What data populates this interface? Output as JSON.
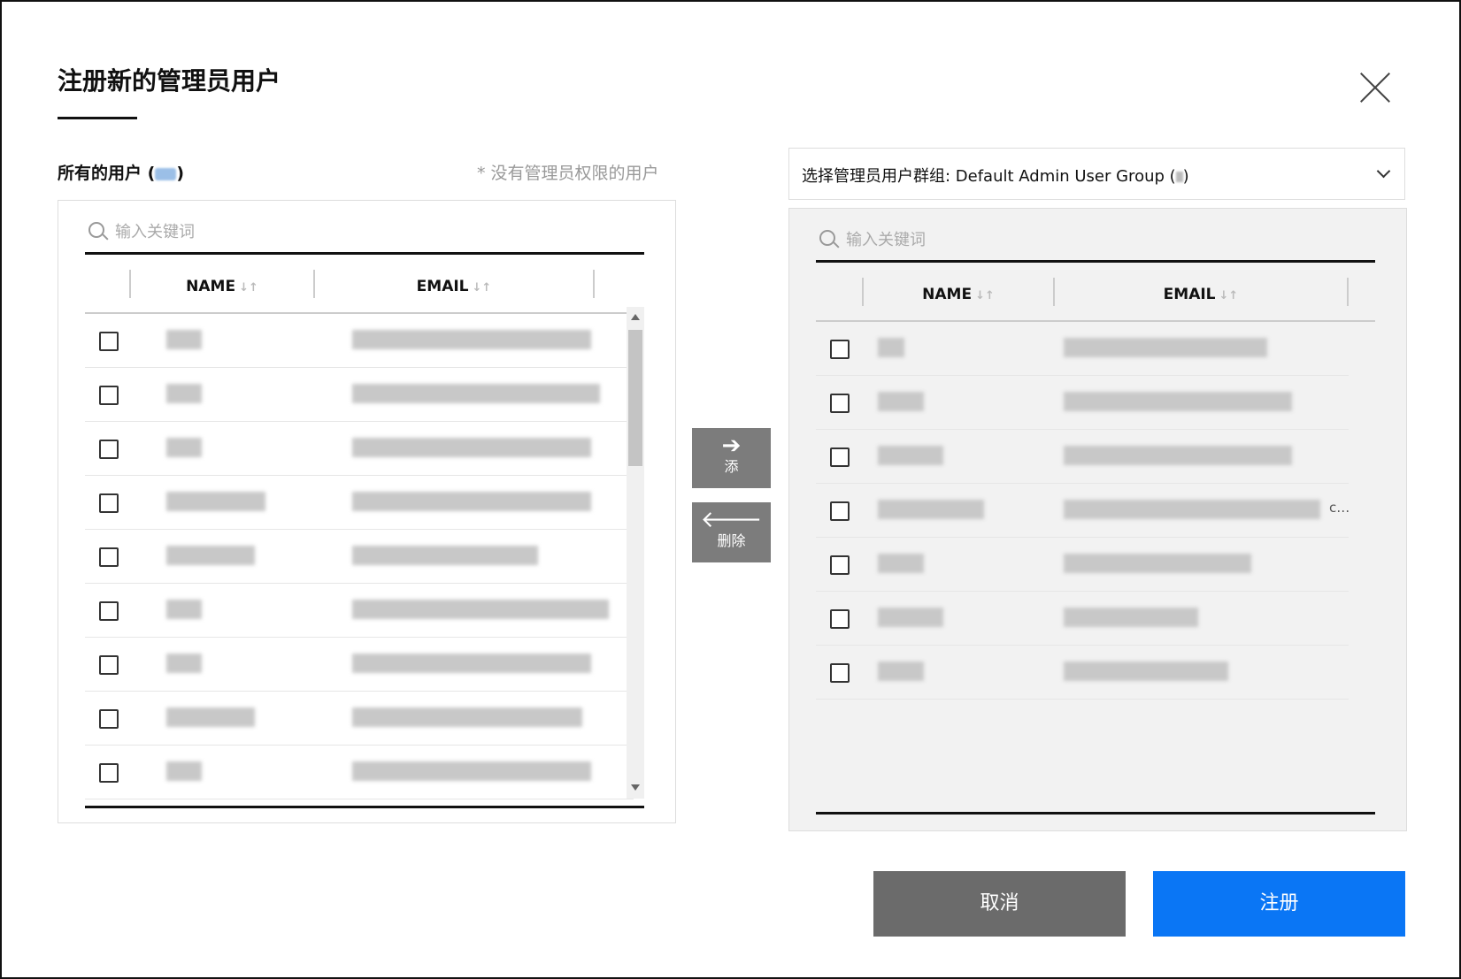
{
  "dialog": {
    "title": "注册新的管理员用户",
    "close_icon": "close-icon"
  },
  "left": {
    "label": "所有的用户 (",
    "label_close": ")",
    "note": "* 没有管理员权限的用户",
    "search_placeholder": "输入关键词",
    "columns": {
      "name": "NAME",
      "email": "EMAIL"
    },
    "sort_glyph": "↓↑"
  },
  "transfer": {
    "add_label": "添",
    "add_icon": "arrow-right-icon",
    "remove_label": "删除",
    "remove_icon": "arrow-left-icon"
  },
  "right": {
    "group_select": "选择管理员用户群组: Default Admin User Group (",
    "group_select_close": ")",
    "search_placeholder": "输入关键词",
    "columns": {
      "name": "NAME",
      "email": "EMAIL"
    },
    "sort_glyph": "↓↑",
    "truncated_suffix": "c…"
  },
  "footer": {
    "cancel_label": "取消",
    "register_label": "注册"
  },
  "colors": {
    "primary": "#0a76f5",
    "cancel": "#6b6b6b",
    "transfer_button": "#7c7c7c"
  }
}
